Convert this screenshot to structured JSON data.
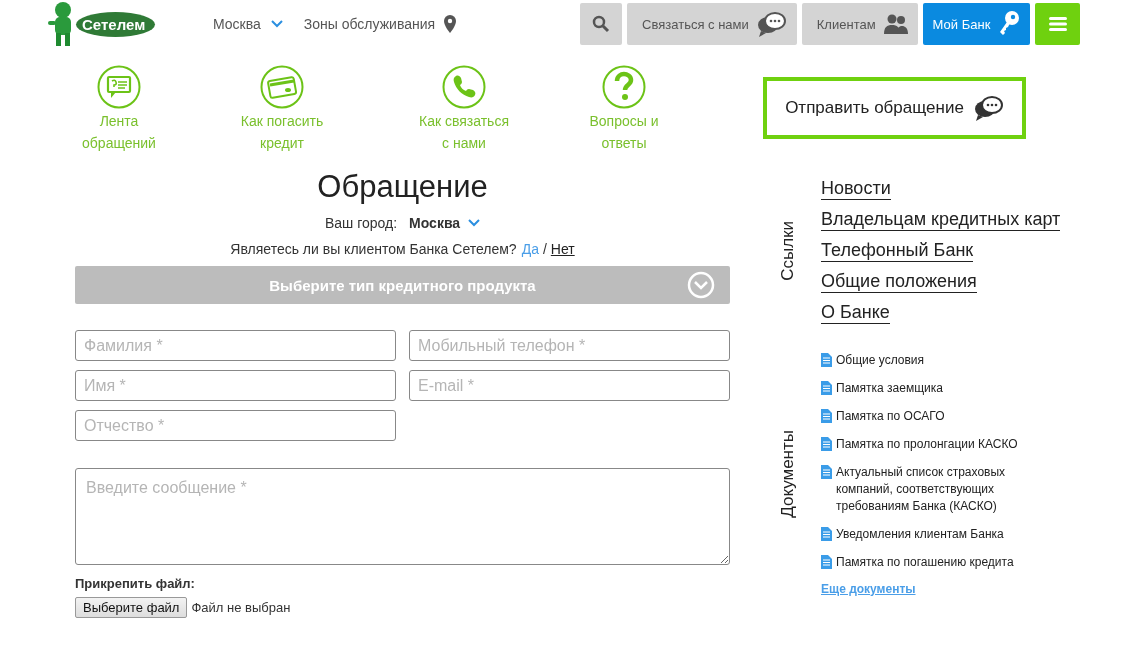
{
  "header": {
    "logo_text": "Сетелем",
    "city": "Москва",
    "zones": "Зоны обслуживания",
    "buttons": [
      {
        "kind": "search"
      },
      {
        "kind": "contact",
        "label": "Связаться с нами"
      },
      {
        "kind": "clients",
        "label": "Клиентам"
      },
      {
        "kind": "bank",
        "label": "Мой Банк"
      },
      {
        "kind": "menu"
      }
    ]
  },
  "quick_links": [
    {
      "kind": "feed",
      "label": "Лента обращений"
    },
    {
      "kind": "card",
      "label": "Как погасить кредит"
    },
    {
      "kind": "phone",
      "label": "Как связаться с нами"
    },
    {
      "kind": "faq",
      "label": "Вопросы и ответы"
    }
  ],
  "form": {
    "title": "Обращение",
    "city_label": "Ваш город:",
    "city": "Москва",
    "client_question": "Являетесь ли вы клиентом Банка Сетелем?",
    "option_separator": "/",
    "client_options": [
      {
        "label": "Да",
        "selected": false
      },
      {
        "label": "Нет",
        "selected": true
      }
    ],
    "product_select": "Выберите тип кредитного продукта",
    "fields": [
      {
        "placeholder": "Фамилия *"
      },
      {
        "placeholder": "Мобильный телефон *"
      },
      {
        "placeholder": "Имя *"
      },
      {
        "placeholder": "E-mail *"
      },
      {
        "placeholder": "Отчество *"
      }
    ],
    "message": {
      "placeholder": "Введите сообщение *"
    },
    "attach_label": "Прикрепить файл:",
    "file_button": "Выберите файл",
    "file_status": "Файл не выбран"
  },
  "sidebar": {
    "send_button": "Отправить обращение",
    "links_title": "Ссылки",
    "links": [
      "Новости",
      "Владельцам кредитных карт",
      "Телефонный Банк",
      "Общие положения",
      "О Банке"
    ],
    "documents_title": "Документы",
    "documents": [
      "Общие условия",
      "Памятка заемщика",
      "Памятка по ОСАГО",
      "Памятка по пролонгации КАСКО",
      "Актуальный список страховых компаний, соответствующих требованиям Банка (КАСКО)",
      "Уведомления клиентам Банка",
      "Памятка по погашению кредита"
    ],
    "more_documents": "Еще документы"
  }
}
